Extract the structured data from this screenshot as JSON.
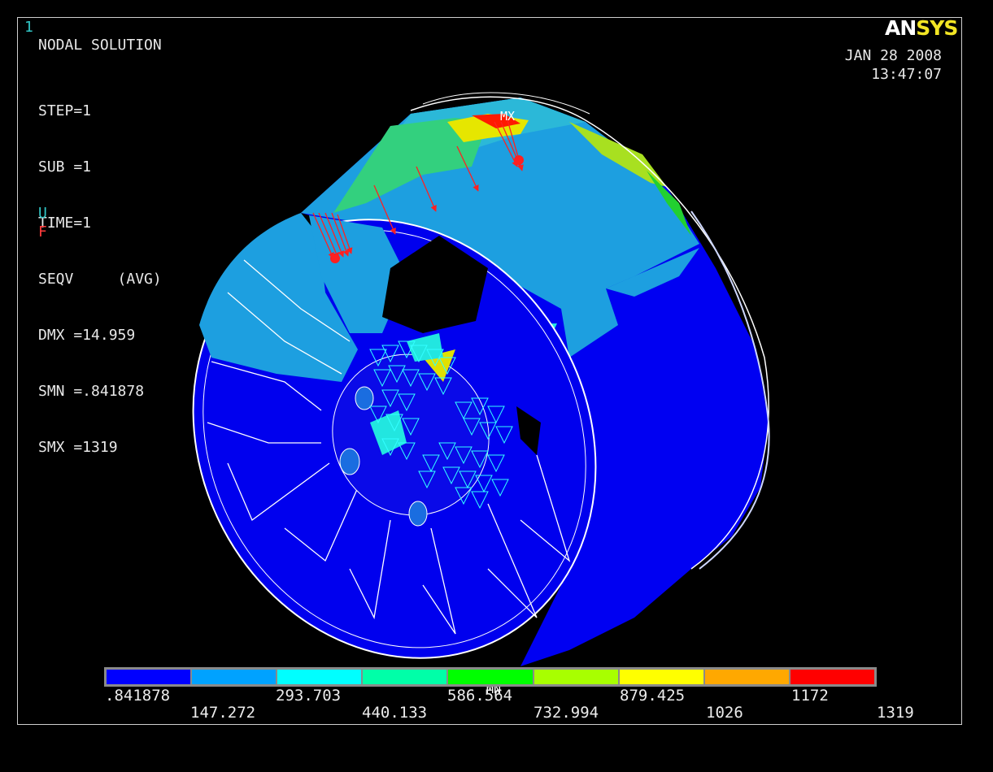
{
  "window": {
    "number": "1",
    "title": "NODAL SOLUTION"
  },
  "info_lines": [
    "STEP=1",
    "SUB =1",
    "TIME=1",
    "SEQV     (AVG)",
    "DMX =14.959",
    "SMN =.841878",
    "SMX =1319"
  ],
  "symbols": {
    "displacement": "U",
    "force": "F"
  },
  "logo": {
    "part1": "AN",
    "part2": "SYS",
    "colors": {
      "an": "#ffffff",
      "sys": "#f2e524"
    }
  },
  "date": "JAN 28 2008",
  "time": "13:47:07",
  "markers": {
    "max": "MX",
    "min": "MN"
  },
  "contour": {
    "colors": [
      "#0000ff",
      "#00a2ff",
      "#00ffff",
      "#00ffa8",
      "#00ff00",
      "#a8ff00",
      "#ffff00",
      "#ffa800",
      "#ff0000"
    ],
    "labels_upper": [
      ".841878",
      "293.703",
      "586.564",
      "879.425",
      "1172"
    ],
    "labels_lower": [
      "147.272",
      "440.133",
      "732.994",
      "1026",
      "1319"
    ]
  }
}
